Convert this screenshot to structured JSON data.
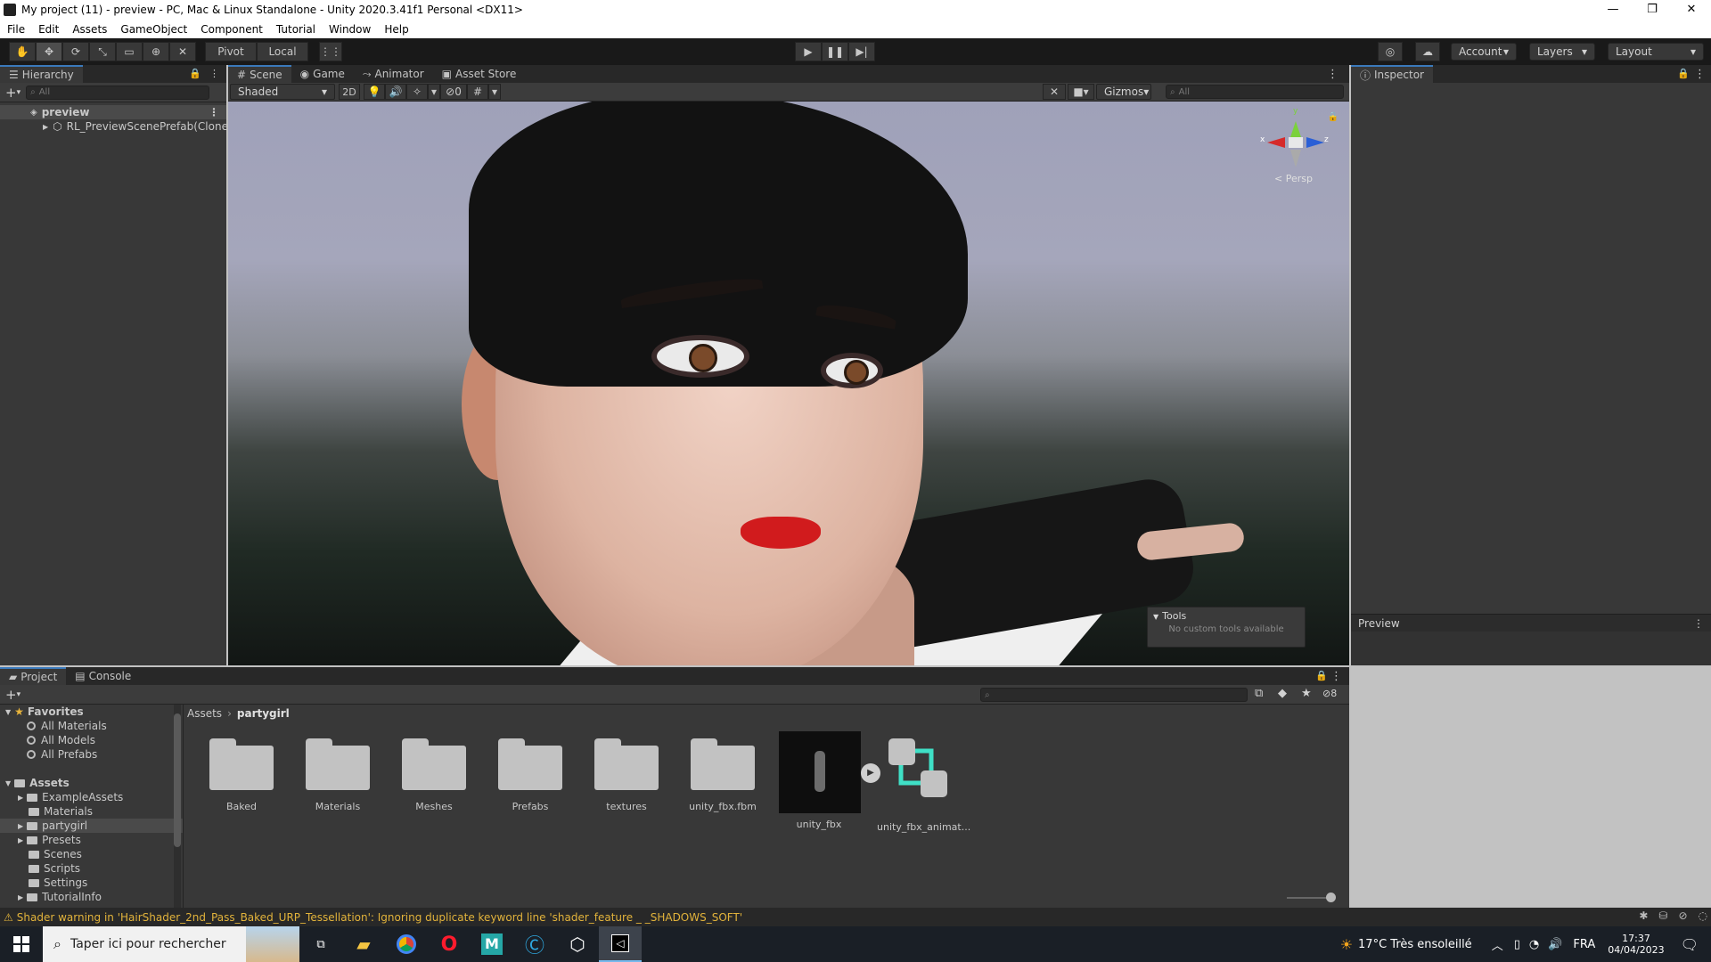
{
  "window": {
    "title": "My project (11) - preview - PC, Mac & Linux Standalone - Unity 2020.3.41f1 Personal <DX11>",
    "min": "—",
    "restore": "❐",
    "close": "✕"
  },
  "menu": [
    "File",
    "Edit",
    "Assets",
    "GameObject",
    "Component",
    "Tutorial",
    "Window",
    "Help"
  ],
  "toolbar": {
    "pivot": "Pivot",
    "local": "Local",
    "account": "Account",
    "layers": "Layers",
    "layout": "Layout"
  },
  "hierarchy": {
    "tab": "Hierarchy",
    "search_placeholder": "All",
    "scene": "preview",
    "child": "RL_PreviewScenePrefab(Clone"
  },
  "scene_tabs": [
    "Scene",
    "Game",
    "Animator",
    "Asset Store"
  ],
  "scene_bar": {
    "shading": "Shaded",
    "mode2d": "2D",
    "hidden_count": "0",
    "gizmos": "Gizmos",
    "search_placeholder": "All"
  },
  "gizmo": {
    "persp": "< Persp",
    "y": "y",
    "x": "x",
    "z": "z"
  },
  "tools_overlay": {
    "title": "Tools",
    "text": "No custom tools available"
  },
  "inspector": {
    "tab": "Inspector",
    "preview": "Preview"
  },
  "project": {
    "tabs": [
      "Project",
      "Console"
    ],
    "hidden_count": "8",
    "breadcrumb": [
      "Assets",
      "partygirl"
    ],
    "favorites": {
      "label": "Favorites",
      "items": [
        "All Materials",
        "All Models",
        "All Prefabs"
      ]
    },
    "assets": {
      "label": "Assets",
      "items": [
        "ExampleAssets",
        "Materials",
        "partygirl",
        "Presets",
        "Scenes",
        "Scripts",
        "Settings",
        "TutorialInfo"
      ]
    },
    "grid": [
      "Baked",
      "Materials",
      "Meshes",
      "Prefabs",
      "textures",
      "unity_fbx.fbm",
      "unity_fbx",
      "unity_fbx_animat..."
    ]
  },
  "status": {
    "message": "Shader warning in 'HairShader_2nd_Pass_Baked_URP_Tessellation': Ignoring duplicate keyword line 'shader_feature _ _SHADOWS_SOFT'"
  },
  "taskbar": {
    "search": "Taper ici pour rechercher",
    "weather": "17°C  Très ensoleillé",
    "lang": "FRA",
    "time": "17:37",
    "date": "04/04/2023"
  }
}
